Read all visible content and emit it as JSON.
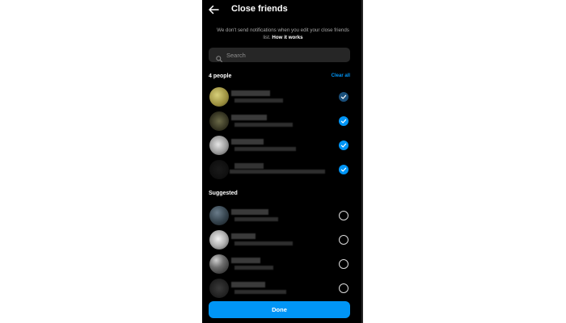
{
  "header": {
    "title": "Close friends",
    "back_icon": "back-arrow-icon"
  },
  "notice": {
    "text": "We don't send notifications when you edit your close friends list.",
    "link": "How it works"
  },
  "search": {
    "placeholder": "Search",
    "value": "",
    "icon": "search-icon"
  },
  "selected_section": {
    "count_label": "4 people",
    "clear_label": "Clear all"
  },
  "suggested_section": {
    "title": "Suggested"
  },
  "selected_people": [
    {
      "state": "selected"
    },
    {
      "state": "selected"
    },
    {
      "state": "selected"
    },
    {
      "state": "selected"
    }
  ],
  "suggested_people": [
    {
      "state": "unselected"
    },
    {
      "state": "unselected"
    },
    {
      "state": "unselected"
    },
    {
      "state": "unselected"
    }
  ],
  "footer": {
    "done_label": "Done"
  },
  "colors": {
    "background": "#000000",
    "accent": "#0095f6",
    "search_bg": "#262626",
    "secondary_text": "#a8a8a8"
  }
}
